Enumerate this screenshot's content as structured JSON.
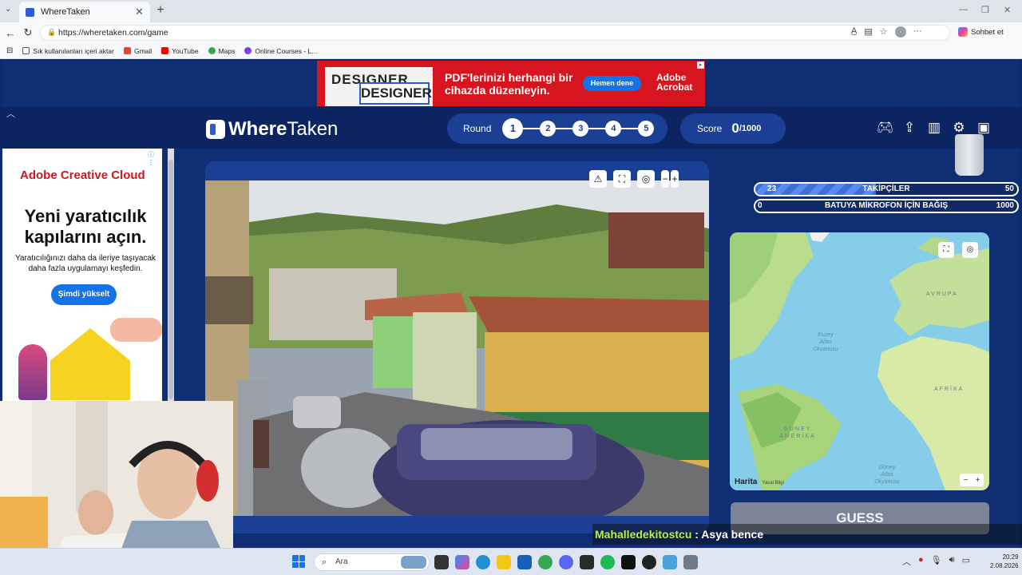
{
  "browser": {
    "tab_title": "WhereTaken",
    "tab_close": "✕",
    "new_tab": "+",
    "url": "https://wheretaken.com/game",
    "window_controls": [
      "—",
      "❐",
      "✕"
    ],
    "profile_action": "Sohbet et",
    "bookmarks": [
      {
        "label": "Sık kullanılanları içeri aktar",
        "color": "#555555"
      },
      {
        "label": "Gmail",
        "color": "#ea4335"
      },
      {
        "label": "YouTube",
        "color": "#ff0000"
      },
      {
        "label": "Maps",
        "color": "#34a853"
      },
      {
        "label": "Online Courses - L...",
        "color": "#7b3fe4"
      }
    ]
  },
  "top_ad": {
    "book_word": "DESIGNER",
    "headline": "PDF'lerinizi herhangi bir cihazda düzenleyin.",
    "button": "Hemen dene",
    "brand_line1": "Adobe",
    "brand_line2": "Acrobat"
  },
  "left_ad": {
    "brand": "Adobe Creative Cloud",
    "headline": "Yeni yaratıcılık kapılarını açın.",
    "body": "Yaratıcılığınızı daha da ileriye taşıyacak daha fazla uygulamayı keşfedin.",
    "button": "Şimdi yükselt"
  },
  "game": {
    "logo_bold": "Where",
    "logo_light": "Taken",
    "round_label": "Round",
    "rounds": [
      "1",
      "2",
      "3",
      "4",
      "5"
    ],
    "current_round": 1,
    "score_label": "Score",
    "score_value": "0",
    "score_max": "/1000",
    "header_icons": [
      "gamepad-icon",
      "share-icon",
      "stats-icon",
      "settings-icon",
      "profile-icon"
    ],
    "photo_tools": [
      "⚠",
      "⛶",
      "◎",
      "−",
      "+"
    ],
    "guess_button": "GUESS"
  },
  "stream_overlay": {
    "bar1": {
      "left": "23",
      "label": "TAKİPÇİLER",
      "right": "50",
      "progress": 0.46
    },
    "bar2": {
      "left": "0",
      "label": "BATUYA MİKROFON İÇİN BAĞIŞ",
      "right": "1000",
      "progress": 0
    },
    "chat_user": "Mahalledekitostcu",
    "chat_message": " : Asya bence"
  },
  "map": {
    "labels": {
      "europe": "AVRUPA",
      "africa": "AFRİKA",
      "south_america_1": "GÜNEY",
      "south_america_2": "AMERİKA",
      "north_atlantic_1": "Kuzey",
      "north_atlantic_2": "Atlas",
      "north_atlantic_3": "Okyanusu",
      "south_atlantic_1": "Güney",
      "south_atlantic_2": "Atlas",
      "south_atlantic_3": "Okyanusu"
    },
    "attribution": "Harita",
    "legal": "Yasal Bilgi",
    "zoom_out": "−",
    "zoom_in": "+"
  },
  "taskbar": {
    "search_placeholder": "Ara",
    "time": "20:29",
    "date": "2.08.2026"
  },
  "colors": {
    "page_bg": "#0f2e74",
    "accent": "#1a3f95",
    "chat_user": "#b5f53a",
    "guess_disabled": "#7b8597"
  }
}
